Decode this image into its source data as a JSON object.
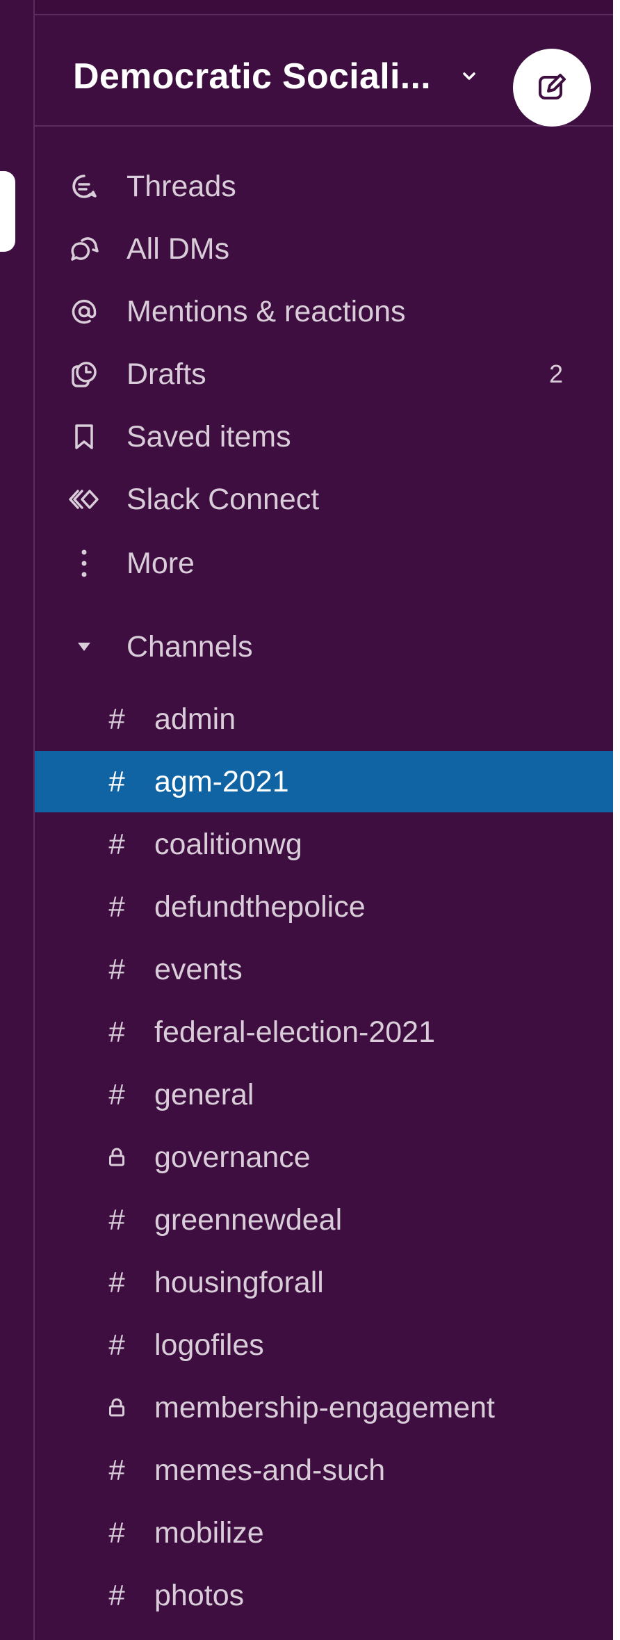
{
  "workspace": {
    "name": "Democratic Sociali...",
    "compose_icon": "pencil-square-icon"
  },
  "nav": [
    {
      "label": "Threads",
      "icon": "threads-icon",
      "badge": ""
    },
    {
      "label": "All DMs",
      "icon": "dms-icon",
      "badge": ""
    },
    {
      "label": "Mentions & reactions",
      "icon": "at-sign-icon",
      "badge": ""
    },
    {
      "label": "Drafts",
      "icon": "drafts-icon",
      "badge": "2"
    },
    {
      "label": "Saved items",
      "icon": "bookmark-icon",
      "badge": ""
    },
    {
      "label": "Slack Connect",
      "icon": "slack-connect-icon",
      "badge": ""
    },
    {
      "label": "More",
      "icon": "more-vertical-icon",
      "badge": ""
    }
  ],
  "channels_section": {
    "label": "Channels",
    "icon": "caret-down-icon"
  },
  "channels": [
    {
      "name": "admin",
      "prefix": "#",
      "private": false,
      "active": false
    },
    {
      "name": "agm-2021",
      "prefix": "#",
      "private": false,
      "active": true
    },
    {
      "name": "coalitionwg",
      "prefix": "#",
      "private": false,
      "active": false
    },
    {
      "name": "defundthepolice",
      "prefix": "#",
      "private": false,
      "active": false
    },
    {
      "name": "events",
      "prefix": "#",
      "private": false,
      "active": false
    },
    {
      "name": "federal-election-2021",
      "prefix": "#",
      "private": false,
      "active": false
    },
    {
      "name": "general",
      "prefix": "#",
      "private": false,
      "active": false
    },
    {
      "name": "governance",
      "prefix": "",
      "private": true,
      "active": false
    },
    {
      "name": "greennewdeal",
      "prefix": "#",
      "private": false,
      "active": false
    },
    {
      "name": "housingforall",
      "prefix": "#",
      "private": false,
      "active": false
    },
    {
      "name": "logofiles",
      "prefix": "#",
      "private": false,
      "active": false
    },
    {
      "name": "membership-engagement",
      "prefix": "",
      "private": true,
      "active": false
    },
    {
      "name": "memes-and-such",
      "prefix": "#",
      "private": false,
      "active": false
    },
    {
      "name": "mobilize",
      "prefix": "#",
      "private": false,
      "active": false
    },
    {
      "name": "photos",
      "prefix": "#",
      "private": false,
      "active": false
    }
  ],
  "colors": {
    "sidebar_bg": "#3f0e40",
    "active_bg": "#1164a3",
    "text": "#d8cdd9",
    "divider": "#5b2c5d"
  }
}
